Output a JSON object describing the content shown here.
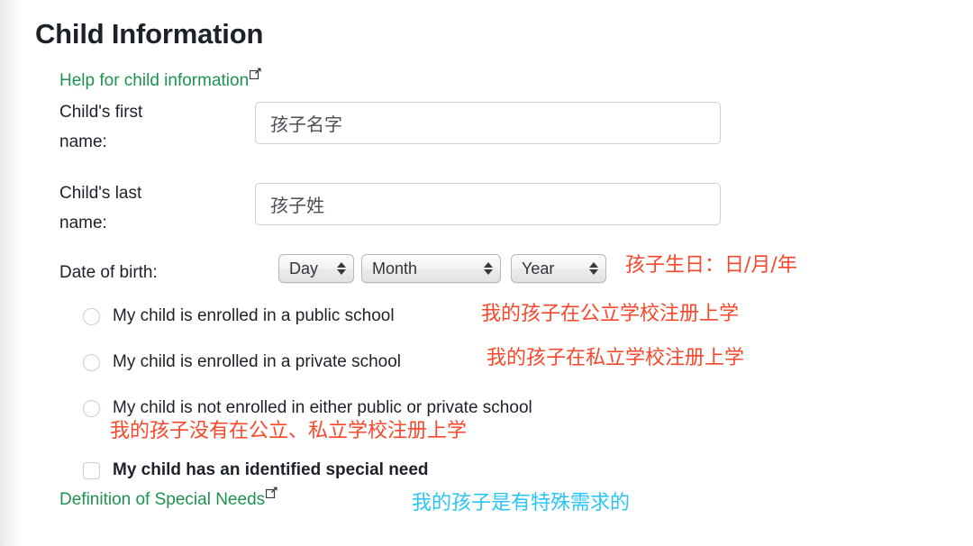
{
  "page": {
    "title": "Child Information"
  },
  "links": {
    "help": {
      "label": "Help for child information",
      "icon": "external-link-icon"
    },
    "definition": {
      "label": "Definition of Special Needs",
      "icon": "external-link-icon"
    }
  },
  "fields": {
    "first_name": {
      "label": "Child's first\nname:",
      "value": "孩子名字",
      "placeholder": "孩子名字"
    },
    "last_name": {
      "label": "Child's last\nname:",
      "value": "孩子姓",
      "placeholder": "孩子姓"
    },
    "date_of_birth": {
      "label": "Date of birth:",
      "day": {
        "selected": "Day"
      },
      "month": {
        "selected": "Month"
      },
      "year": {
        "selected": "Year"
      }
    }
  },
  "choices": {
    "public_school": {
      "label": "My child is enrolled in a public school",
      "checked": false
    },
    "private_school": {
      "label": "My child is enrolled in a private school",
      "checked": false
    },
    "neither_school": {
      "label": "My child is not enrolled in either public or private school",
      "checked": false
    },
    "special_need": {
      "label": "My child has an identified special need",
      "checked": false
    }
  },
  "annotations": {
    "date_of_birth": "孩子生日：日/月/年",
    "public_school": "我的孩子在公立学校注册上学",
    "private_school": "我的孩子在私立学校注册上学",
    "neither_school": "我的孩子没有在公立、私立学校注册上学",
    "special_need": "我的孩子是有特殊需求的"
  },
  "colors": {
    "link_green": "#1e9251",
    "annotation_red": "#f9472b",
    "annotation_cyan": "#29c5f6",
    "text": "#1d2129"
  }
}
